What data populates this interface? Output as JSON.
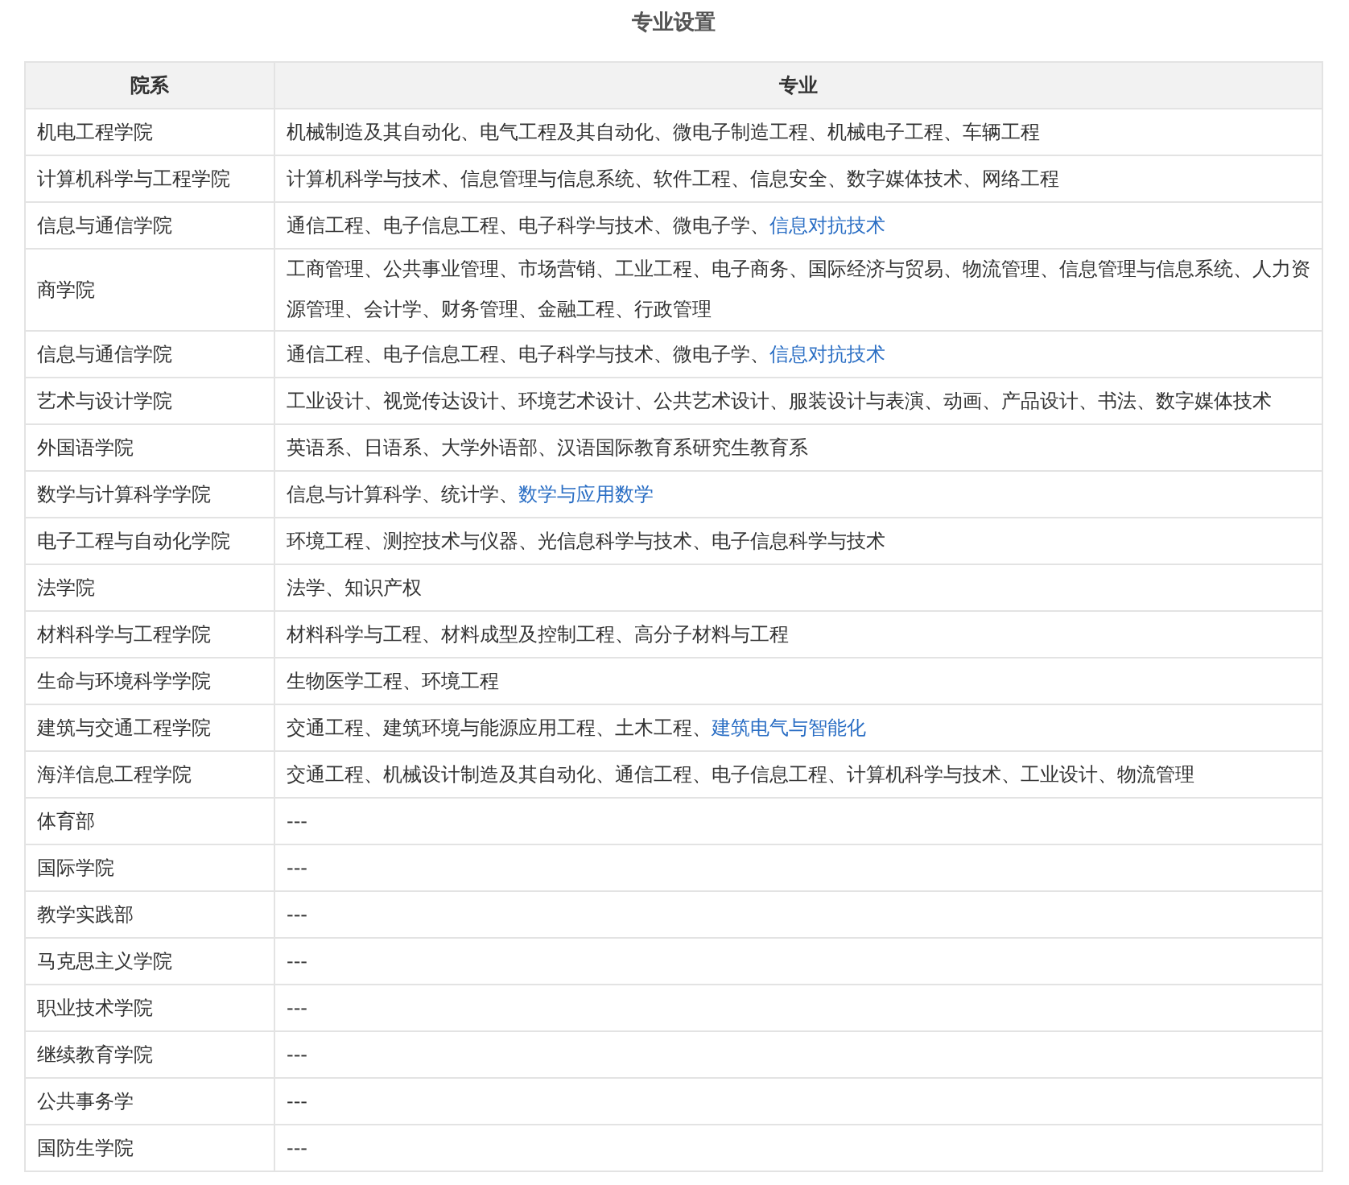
{
  "title": "专业设置",
  "table": {
    "columns": [
      "院系",
      "专业"
    ],
    "rows": [
      {
        "department": "机电工程学院",
        "majors": [
          {
            "text": "机械制造及其自动化、电气工程及其自动化、微电子制造工程、机械电子工程、车辆工程",
            "link": false
          }
        ]
      },
      {
        "department": "计算机科学与工程学院",
        "majors": [
          {
            "text": "计算机科学与技术、信息管理与信息系统、软件工程、信息安全、数字媒体技术、网络工程",
            "link": false
          }
        ]
      },
      {
        "department": "信息与通信学院",
        "majors": [
          {
            "text": "通信工程、电子信息工程、电子科学与技术、微电子学、",
            "link": false
          },
          {
            "text": "信息对抗技术",
            "link": true
          }
        ]
      },
      {
        "department": "商学院",
        "majors": [
          {
            "text": "工商管理、公共事业管理、市场营销、工业工程、电子商务、国际经济与贸易、物流管理、信息管理与信息系统、人力资源管理、会计学、财务管理、金融工程、行政管理",
            "link": false
          }
        ]
      },
      {
        "department": "信息与通信学院",
        "majors": [
          {
            "text": "通信工程、电子信息工程、电子科学与技术、微电子学、",
            "link": false
          },
          {
            "text": "信息对抗技术",
            "link": true
          }
        ]
      },
      {
        "department": "艺术与设计学院",
        "majors": [
          {
            "text": "工业设计、视觉传达设计、环境艺术设计、公共艺术设计、服装设计与表演、动画、产品设计、书法、数字媒体技术",
            "link": false
          }
        ]
      },
      {
        "department": "外国语学院",
        "majors": [
          {
            "text": "英语系、日语系、大学外语部、汉语国际教育系研究生教育系",
            "link": false
          }
        ]
      },
      {
        "department": "数学与计算科学学院",
        "majors": [
          {
            "text": "信息与计算科学、统计学、",
            "link": false
          },
          {
            "text": "数学与应用数学",
            "link": true
          }
        ]
      },
      {
        "department": "电子工程与自动化学院",
        "majors": [
          {
            "text": "环境工程、测控技术与仪器、光信息科学与技术、电子信息科学与技术",
            "link": false
          }
        ]
      },
      {
        "department": "法学院",
        "majors": [
          {
            "text": "法学、知识产权",
            "link": false
          }
        ]
      },
      {
        "department": "材料科学与工程学院",
        "majors": [
          {
            "text": "材料科学与工程、材料成型及控制工程、高分子材料与工程",
            "link": false
          }
        ]
      },
      {
        "department": "生命与环境科学学院",
        "majors": [
          {
            "text": "生物医学工程、环境工程",
            "link": false
          }
        ]
      },
      {
        "department": "建筑与交通工程学院",
        "majors": [
          {
            "text": "交通工程、建筑环境与能源应用工程、土木工程、",
            "link": false
          },
          {
            "text": "建筑电气与智能化",
            "link": true
          }
        ]
      },
      {
        "department": "海洋信息工程学院",
        "majors": [
          {
            "text": "交通工程、机械设计制造及其自动化、通信工程、电子信息工程、计算机科学与技术、工业设计、物流管理",
            "link": false
          }
        ]
      },
      {
        "department": "体育部",
        "majors": [
          {
            "text": "---",
            "link": false
          }
        ]
      },
      {
        "department": "国际学院",
        "majors": [
          {
            "text": "---",
            "link": false
          }
        ]
      },
      {
        "department": "教学实践部",
        "majors": [
          {
            "text": "---",
            "link": false
          }
        ]
      },
      {
        "department": "马克思主义学院",
        "majors": [
          {
            "text": "---",
            "link": false
          }
        ]
      },
      {
        "department": "职业技术学院",
        "majors": [
          {
            "text": "---",
            "link": false
          }
        ]
      },
      {
        "department": "继续教育学院",
        "majors": [
          {
            "text": "---",
            "link": false
          }
        ]
      },
      {
        "department": "公共事务学",
        "majors": [
          {
            "text": "---",
            "link": false
          }
        ]
      },
      {
        "department": "国防生学院",
        "majors": [
          {
            "text": "---",
            "link": false
          }
        ]
      }
    ]
  }
}
